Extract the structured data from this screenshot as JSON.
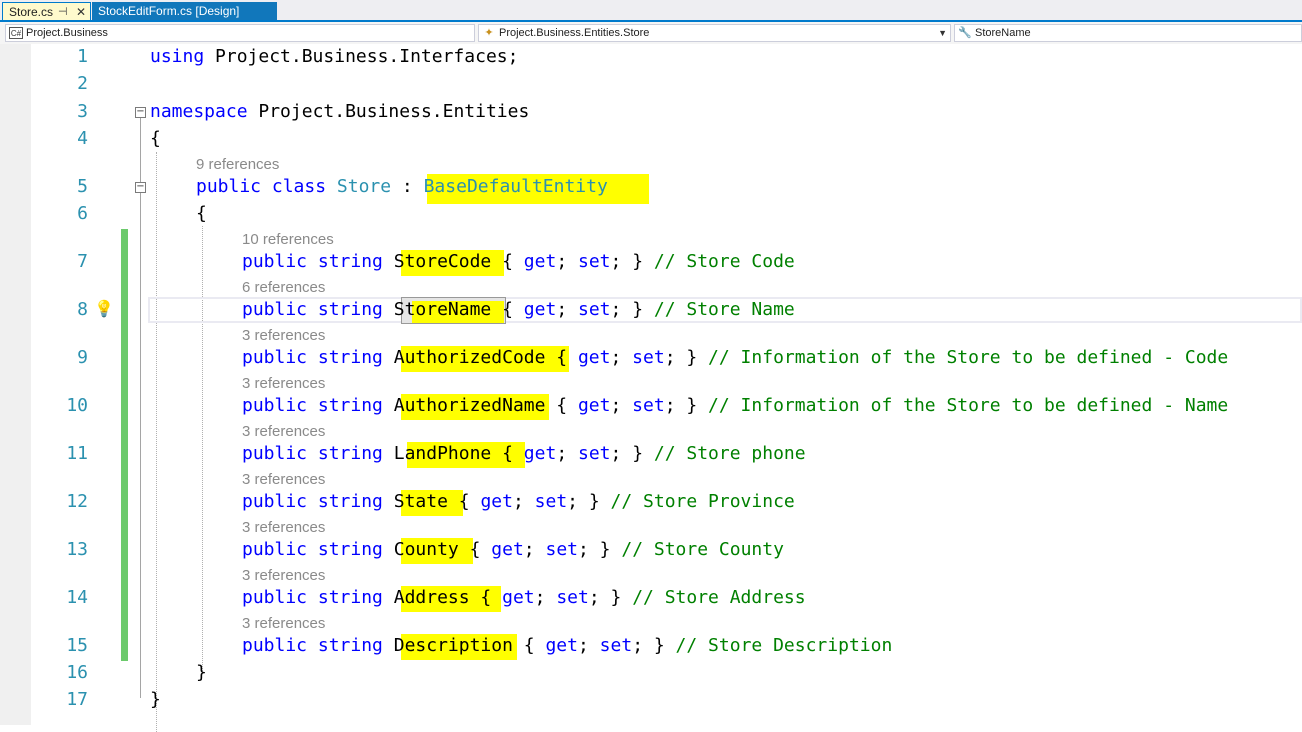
{
  "tabs": [
    {
      "label": "Store.cs",
      "active": true
    },
    {
      "label": "StockEditForm.cs [Design]",
      "active": false
    }
  ],
  "nav": {
    "project": "Project.Business",
    "type": "Project.Business.Entities.Store",
    "member": "StoreName"
  },
  "lines": [
    {
      "n": "1"
    },
    {
      "n": "2"
    },
    {
      "n": "3"
    },
    {
      "n": "4"
    },
    {
      "n": "5"
    },
    {
      "n": "6"
    },
    {
      "n": "7"
    },
    {
      "n": "8"
    },
    {
      "n": "9"
    },
    {
      "n": "10"
    },
    {
      "n": "11"
    },
    {
      "n": "12"
    },
    {
      "n": "13"
    },
    {
      "n": "14"
    },
    {
      "n": "15"
    },
    {
      "n": "16"
    },
    {
      "n": "17"
    }
  ],
  "code": {
    "using_kw": "using",
    "using_ns": " Project.Business.Interfaces;",
    "ns_kw": "namespace",
    "ns_name": " Project.Business.Entities",
    "open_brace": "{",
    "close_brace": "}",
    "class_lens": "9 references",
    "class_kw": "public class",
    "class_name": "Store",
    "class_colon": " : ",
    "base_class": "BaseDefaultEntity",
    "props": [
      {
        "lens": "10 references",
        "name": "StoreCode",
        "comment": "// Store Code"
      },
      {
        "lens": "6 references",
        "name": "StoreName",
        "comment": "// Store Name"
      },
      {
        "lens": "3 references",
        "name": "AuthorizedCode",
        "comment": "// Information of the Store to be defined - Code"
      },
      {
        "lens": "3 references",
        "name": "AuthorizedName",
        "comment": "// Information of the Store to be defined - Name"
      },
      {
        "lens": "3 references",
        "name": "LandPhone",
        "comment": "// Store phone"
      },
      {
        "lens": "3 references",
        "name": "State",
        "comment": "// Store Province"
      },
      {
        "lens": "3 references",
        "name": "County",
        "comment": "// Store County"
      },
      {
        "lens": "3 references",
        "name": "Address",
        "comment": "// Store Address"
      },
      {
        "lens": "3 references",
        "name": "Description",
        "comment": "// Store Description"
      }
    ],
    "prop_kw": "public string",
    "accessors_open": " { ",
    "get_kw": "get",
    "set_kw": "set",
    "accessors_close": "; } "
  },
  "colors": {
    "keyword": "#0000ff",
    "type": "#2b91af",
    "comment": "#008000",
    "highlight": "#ffff00",
    "changebar": "#6cca6c"
  }
}
